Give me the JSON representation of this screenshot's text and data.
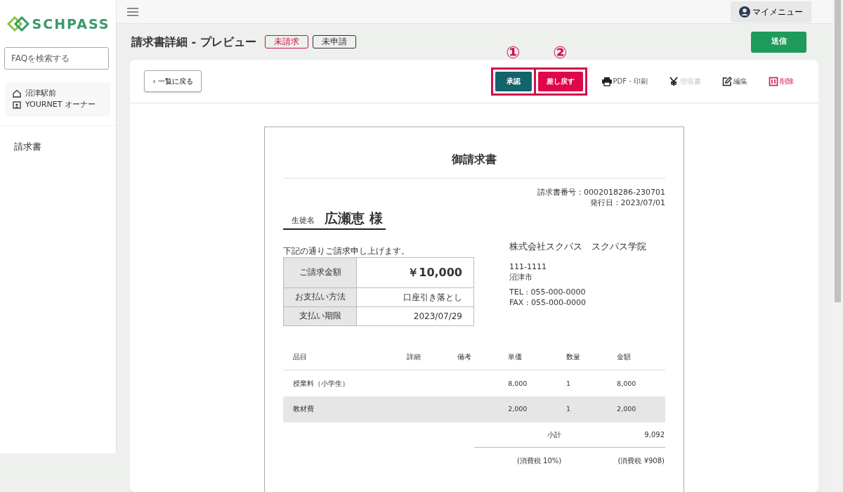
{
  "sidebar": {
    "logo": "SCHPASS",
    "search": {
      "placeholder": "FAQを検索する"
    },
    "account": {
      "school": "沼津駅前",
      "user": "YOURNET オーナー"
    },
    "items": [
      {
        "label": "請求書",
        "selected": false
      }
    ]
  },
  "topbar": {
    "my_menu": "マイメニュー"
  },
  "page": {
    "title": "請求書詳細 - プレビュー",
    "badges": [
      {
        "label": "未請求",
        "color": "#d0104c"
      },
      {
        "label": "未申請",
        "color": "#333333"
      }
    ],
    "send_button": "送信"
  },
  "toolbar": {
    "back": "‹ 一覧に戻る",
    "actions": [
      {
        "kind": "approve",
        "label": "承認",
        "callout": "①"
      },
      {
        "kind": "reject",
        "label": "差し戻す",
        "callout": "②"
      }
    ],
    "links": [
      {
        "kind": "print",
        "label": "PDF・印刷",
        "disabled": false
      },
      {
        "kind": "receipt",
        "label": "領収書",
        "disabled": true
      },
      {
        "kind": "edit",
        "label": "編集",
        "disabled": false
      },
      {
        "kind": "delete",
        "label": "削除",
        "disabled": false
      }
    ]
  },
  "invoice": {
    "title": "御請求書",
    "number": "請求書番号：0002018286-230701",
    "issued": "発行日：2023/07/01",
    "student_label": "生徒名",
    "student_name": "広瀬恵 様",
    "note": "下記の通りご請求申し上げます。",
    "summary": [
      {
        "label": "ご請求金額",
        "value": "￥10,000"
      },
      {
        "label": "お支払い方法",
        "value": "口座引き落とし"
      },
      {
        "label": "支払い期限",
        "value": "2023/07/29"
      }
    ],
    "company": {
      "name": "株式会社スクパス　スクパス学院",
      "postal": "111-1111",
      "city": "沼津市",
      "tel": "TEL : 055-000-0000",
      "fax": "FAX : 055-000-0000"
    },
    "columns": [
      "品目",
      "詳細",
      "備考",
      "単価",
      "数量",
      "金額"
    ],
    "rows": [
      {
        "cells": [
          "授業料（小学生）",
          "",
          "",
          "8,000",
          "1",
          "8,000"
        ]
      },
      {
        "cells": [
          "教材費",
          "",
          "",
          "2,000",
          "1",
          "2,000"
        ]
      }
    ],
    "subtotal_label": "小計",
    "subtotal": "9,092",
    "tax_label": "(消費税 10%)",
    "tax": "(消費税 ¥908)"
  }
}
